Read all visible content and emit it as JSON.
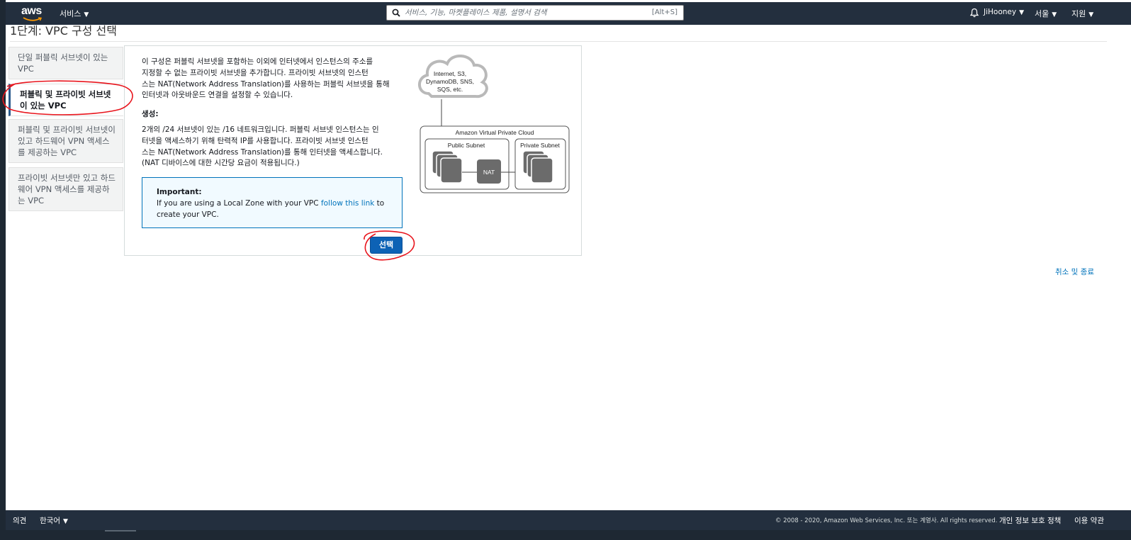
{
  "nav": {
    "logo_text": "aws",
    "services_label": "서비스",
    "search_placeholder": "서비스, 기능, 마켓플레이스 제품, 설명서 검색",
    "search_shortcut": "[Alt+S]",
    "user_label": "JiHooney",
    "region_label": "서울",
    "support_label": "지원"
  },
  "page": {
    "title": "1단계: VPC 구성 선택"
  },
  "options": [
    {
      "label": "단일 퍼블릭 서브넷이 있는 VPC",
      "selected": false
    },
    {
      "label": "퍼블릭 및 프라이빗 서브넷이 있는 VPC",
      "selected": true
    },
    {
      "label": "퍼블릭 및 프라이빗 서브넷이 있고 하드웨어 VPN 액세스를 제공하는 VPC",
      "selected": false
    },
    {
      "label": "프라이빗 서브넷만 있고 하드웨어 VPN 액세스를 제공하는 VPC",
      "selected": false
    }
  ],
  "content": {
    "description_lines": [
      "이 구성은 퍼블릭 서브넷을 포함하는 이외에 인터넷에서 인스턴스의 주소를",
      "지정할 수 없는 프라이빗 서브넷을 추가합니다. 프라이빗 서브넷의 인스턴",
      "스는 NAT(Network Address Translation)를 사용하는 퍼블릭 서브넷을 통해",
      "인터넷과 아웃바운드 연결을 설정할 수 있습니다."
    ],
    "creates_label": "생성:",
    "creates_lines": [
      "2개의 /24 서브넷이 있는 /16 네트워크입니다. 퍼블릭 서브넷 인스턴스는 인",
      "터넷을 액세스하기 위해 탄력적 IP를 사용합니다. 프라이빗 서브넷 인스턴",
      "스는 NAT(Network Address Translation)를 통해 인터넷을 액세스합니다.",
      "(NAT 디바이스에 대한 시간당 요금이 적용됩니다.)"
    ],
    "important": {
      "title": "Important:",
      "text_before": "If you are using a Local Zone with your VPC",
      "link": "follow this link",
      "text_after": "to",
      "text_line2": "create your VPC."
    },
    "select_button": "선택"
  },
  "diagram": {
    "cloud_lines": [
      "Internet, S3,",
      "DynamoDB, SNS,",
      "SQS, etc."
    ],
    "vpc_label": "Amazon Virtual Private Cloud",
    "public_subnet": "Public Subnet",
    "private_subnet": "Private Subnet",
    "nat_label": "NAT"
  },
  "cancel_link": "취소 및 종료",
  "footer": {
    "feedback": "의견",
    "language": "한국어",
    "copyright": "© 2008 - 2020, Amazon Web Services, Inc. 또는 계열사. All rights reserved.",
    "privacy": "개인 정보 보호 정책",
    "terms": "이용 약관"
  },
  "colors": {
    "nav_bg": "#232f3e",
    "accent": "#0073bb",
    "button": "#0d62b5",
    "annotation": "#e8141c"
  }
}
